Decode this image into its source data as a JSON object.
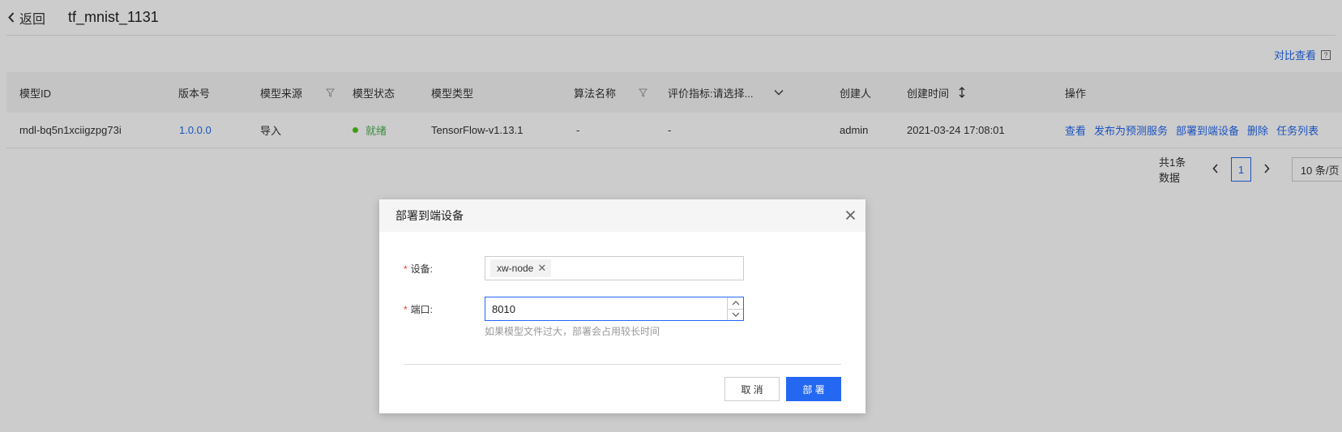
{
  "header": {
    "back_label": "返回",
    "title": "tf_mnist_1131"
  },
  "toolbar": {
    "compare_label": "对比查看",
    "compare_help": "?"
  },
  "table": {
    "columns": {
      "model_id": "模型ID",
      "version": "版本号",
      "source": "模型来源",
      "status": "模型状态",
      "type": "模型类型",
      "algorithm": "算法名称",
      "metric": "评价指标:请选择...",
      "creator": "创建人",
      "created": "创建时间",
      "actions": "操作"
    },
    "rows": [
      {
        "model_id": "mdl-bq5n1xciigzpg73i",
        "version": "1.0.0.0",
        "source": "导入",
        "status": "就绪",
        "type": "TensorFlow-v1.13.1",
        "algorithm": "-",
        "metric": "-",
        "creator": "admin",
        "created": "2021-03-24 17:08:01",
        "actions": [
          "查看",
          "发布为预测服务",
          "部署到端设备",
          "删除",
          "任务列表"
        ]
      }
    ]
  },
  "pagination": {
    "total": "共1条数据",
    "current": "1",
    "page_size": "10 条/页"
  },
  "modal": {
    "title": "部署到端设备",
    "device_label": "设备:",
    "device_tag": "xw-node",
    "port_label": "端口:",
    "port_value": "8010",
    "hint": "如果模型文件过大，部署会占用较长时间",
    "cancel_label": "取 消",
    "deploy_label": "部 署"
  },
  "colors": {
    "accent": "#2468f2",
    "status_ready": "#52c41a",
    "required": "#e53935"
  }
}
